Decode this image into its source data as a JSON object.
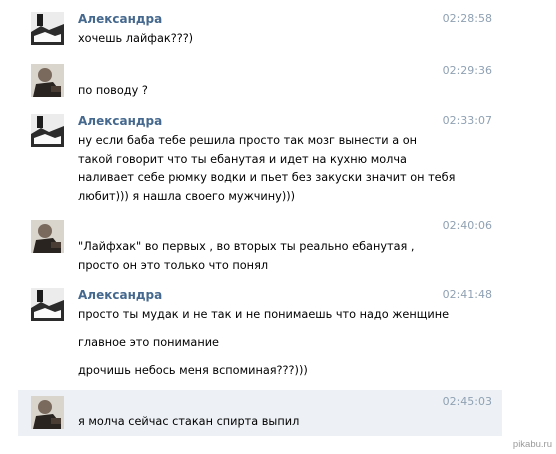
{
  "messages": [
    {
      "avatar": "alexandra-avatar",
      "author": "Александра",
      "time": "02:28:58",
      "lines": [
        "хочешь лайфак???)"
      ]
    },
    {
      "avatar": "male-avatar",
      "author": "",
      "time": "02:29:36",
      "lines": [
        "по поводу ?"
      ]
    },
    {
      "avatar": "alexandra-avatar",
      "author": "Александра",
      "time": "02:33:07",
      "lines": [
        "ну если баба тебе решила просто так мозг вынести а он",
        "такой говорит что ты ебанутая и идет на кухню молча",
        "наливает себе рюмку водки и пьет без закуски значит он тебя",
        "любит))) я нашла своего мужчину)))"
      ]
    },
    {
      "avatar": "male-avatar",
      "author": "",
      "time": "02:40:06",
      "lines": [
        "\"Лайфхак\" во первых , во вторых ты реально ебанутая ,",
        "просто он это только что понял"
      ]
    },
    {
      "avatar": "alexandra-avatar",
      "author": "Александра",
      "time": "02:41:48",
      "lines": [
        "просто ты мудак и не так и не понимаешь что надо женщине",
        "главное это понимание",
        "дрочишь небось меня вспоминая???)))"
      ]
    },
    {
      "avatar": "male-avatar",
      "author": "",
      "time": "02:45:03",
      "lines": [
        "я молча сейчас стакан спирта выпил"
      ]
    }
  ],
  "watermark": "pikabu.ru",
  "colors": {
    "author": "#45688e",
    "time": "#8fa1b3",
    "highlight": "#edf1f5"
  }
}
